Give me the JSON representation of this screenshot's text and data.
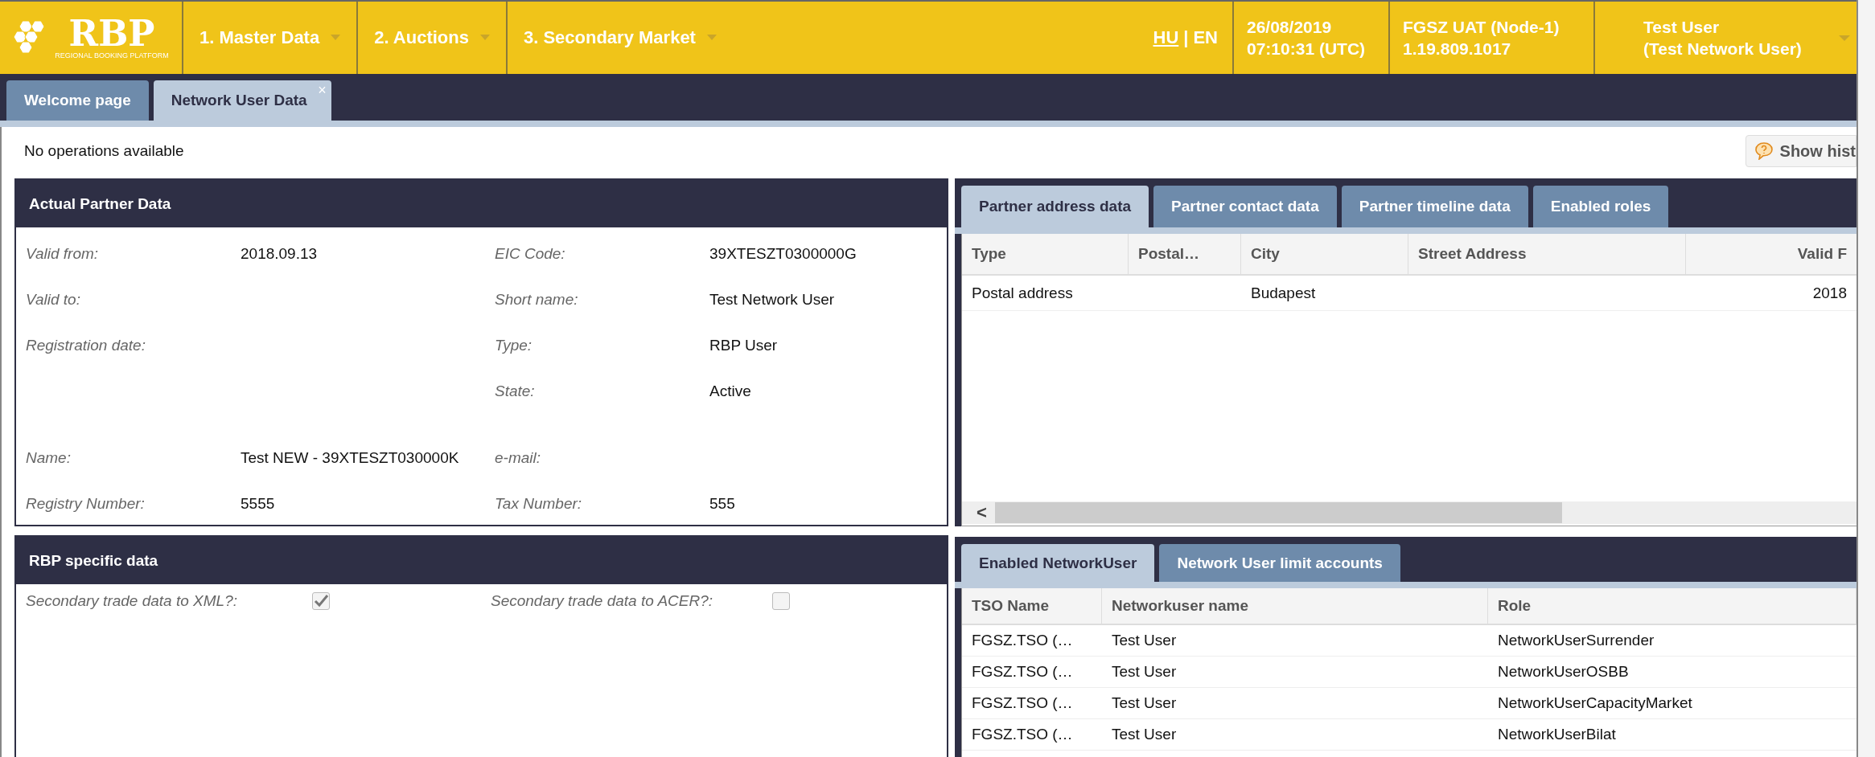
{
  "logo": {
    "text": "RBP",
    "tagline": "REGIONAL BOOKING PLATFORM"
  },
  "menu": [
    {
      "label": "1. Master Data"
    },
    {
      "label": "2. Auctions"
    },
    {
      "label": "3. Secondary Market"
    }
  ],
  "languages": [
    {
      "label": "HU",
      "selected": true
    },
    {
      "label": "EN",
      "selected": false
    }
  ],
  "language_separator": "|",
  "datetime": [
    "26/08/2019",
    "07:10:31 (UTC)"
  ],
  "environment": [
    "FGSZ UAT (Node-1)",
    "1.19.809.1017"
  ],
  "user": [
    "Test User",
    "(Test Network User)"
  ],
  "page_tabs": [
    {
      "label": "Welcome page",
      "selected": false
    },
    {
      "label": "Network User Data",
      "selected": true,
      "close": "×"
    }
  ],
  "toolbar": {
    "message": "No operations available",
    "history_button": "Show hist"
  },
  "partner_panel": {
    "title": "Actual Partner Data",
    "groups": [
      [
        {
          "left": {
            "label": "Valid from:",
            "value": "2018.09.13"
          },
          "right": {
            "label": "EIC Code:",
            "value": "39XTESZT0300000G"
          }
        },
        {
          "left": {
            "label": "Valid to:"
          },
          "right": {
            "label": "Short name:",
            "value": "Test Network User"
          }
        },
        {
          "left": {
            "label": "Registration date:"
          },
          "right": {
            "label": "Type:",
            "value": "RBP User"
          }
        },
        {
          "right": {
            "label": "State:",
            "value": "Active"
          }
        }
      ],
      [
        {
          "left": {
            "label": "Name:",
            "value": "Test NEW - 39XTESZT030000K"
          },
          "right": {
            "label": "e-mail:"
          }
        },
        {
          "left": {
            "label": "Registry Number:",
            "value": "5555"
          },
          "right": {
            "label": "Tax Number:",
            "value": "555"
          }
        }
      ]
    ]
  },
  "rbp_panel": {
    "title": "RBP specific data",
    "options": [
      {
        "label": "Secondary trade data to XML?:",
        "checked": true
      },
      {
        "label": "Secondary trade data to ACER?:",
        "checked": false
      }
    ]
  },
  "address_tabs": [
    {
      "label": "Partner address data",
      "selected": true
    },
    {
      "label": "Partner contact data",
      "selected": false
    },
    {
      "label": "Partner timeline data",
      "selected": false
    },
    {
      "label": "Enabled roles",
      "selected": false
    }
  ],
  "address_table": {
    "columns": [
      "Type",
      "Postal…",
      "City",
      "Street Address",
      "Valid F"
    ],
    "rows": [
      [
        "Postal address",
        "",
        "Budapest",
        "",
        "2018"
      ]
    ],
    "scroll_left": "<"
  },
  "networkuser_tabs": [
    {
      "label": "Enabled NetworkUser",
      "selected": true
    },
    {
      "label": "Network User limit accounts",
      "selected": false
    }
  ],
  "networkuser_table": {
    "columns": [
      "TSO Name",
      "Networkuser name",
      "Role"
    ],
    "rows": [
      [
        "FGSZ.TSO (…",
        "Test User",
        "NetworkUserSurrender"
      ],
      [
        "FGSZ.TSO (…",
        "Test User",
        "NetworkUserOSBB"
      ],
      [
        "FGSZ.TSO (…",
        "Test User",
        "NetworkUserCapacityMarket"
      ],
      [
        "FGSZ.TSO (…",
        "Test User",
        "NetworkUserBilat"
      ]
    ]
  }
}
